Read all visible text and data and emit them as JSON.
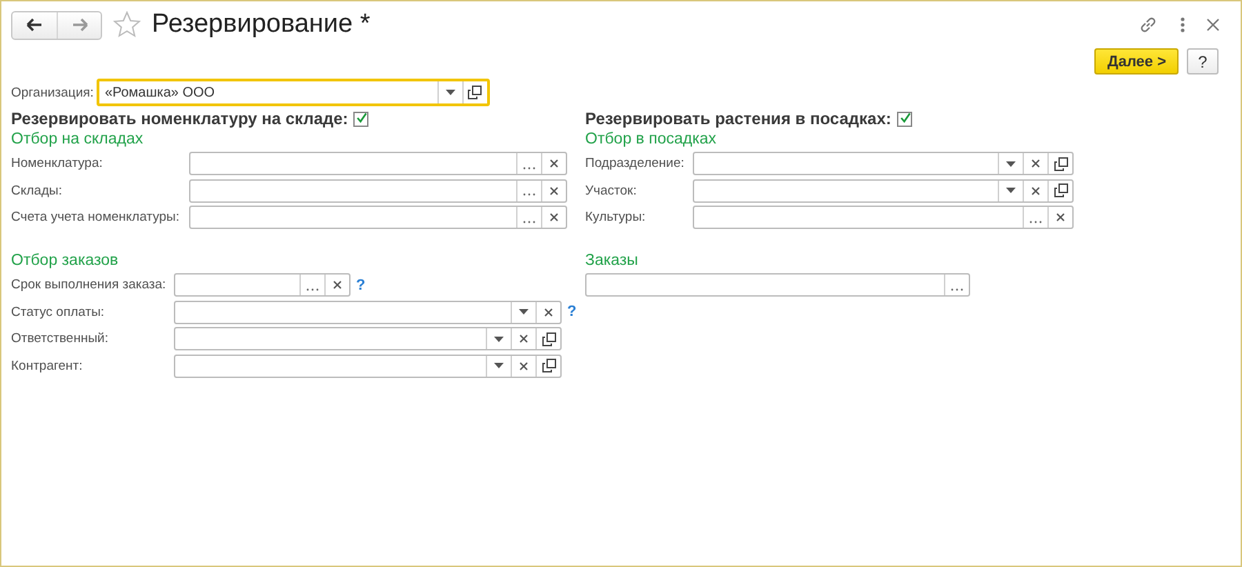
{
  "window": {
    "title": "Резервирование *"
  },
  "toolbar": {
    "next_button": "Далее >",
    "help_button": "?"
  },
  "organization": {
    "label": "Организация:",
    "value": "«Ромашка» ООО",
    "focused": true,
    "buttons": [
      {
        "kind": "dropdown"
      },
      {
        "kind": "open"
      }
    ]
  },
  "warehouse": {
    "title": "Резервировать номенклатуру на складе:",
    "checked": true,
    "filter_title": "Отбор на складах",
    "fields": [
      {
        "label": "Номенклатура:",
        "buttons": [
          {
            "kind": "select"
          },
          {
            "kind": "clear"
          }
        ]
      },
      {
        "label": "Склады:",
        "buttons": [
          {
            "kind": "select"
          },
          {
            "kind": "clear"
          }
        ]
      },
      {
        "label": "Счета учета номенклатуры:",
        "buttons": [
          {
            "kind": "select"
          },
          {
            "kind": "clear"
          }
        ]
      }
    ]
  },
  "orders_filter": {
    "title": "Отбор заказов",
    "fields": [
      {
        "label": "Срок выполнения заказа:",
        "kind": "short",
        "buttons": [
          {
            "kind": "select"
          },
          {
            "kind": "clear"
          }
        ],
        "help": "?"
      },
      {
        "label": "Статус оплаты:",
        "kind": "wide",
        "buttons": [
          {
            "kind": "dropdown"
          },
          {
            "kind": "clear"
          }
        ],
        "help": "?"
      },
      {
        "label": "Ответственный:",
        "kind": "wide",
        "buttons": [
          {
            "kind": "dropdown"
          },
          {
            "kind": "clear"
          },
          {
            "kind": "open"
          }
        ]
      },
      {
        "label": "Контрагент:",
        "kind": "wide",
        "buttons": [
          {
            "kind": "dropdown"
          },
          {
            "kind": "clear"
          },
          {
            "kind": "open"
          }
        ]
      }
    ]
  },
  "plantings": {
    "title": "Резервировать растения в посадках:",
    "checked": true,
    "filter_title": "Отбор в посадках",
    "fields": [
      {
        "label": "Подразделение:",
        "buttons": [
          {
            "kind": "dropdown"
          },
          {
            "kind": "clear"
          },
          {
            "kind": "open"
          }
        ]
      },
      {
        "label": "Участок:",
        "buttons": [
          {
            "kind": "dropdown"
          },
          {
            "kind": "clear"
          },
          {
            "kind": "open"
          }
        ]
      },
      {
        "label": "Культуры:",
        "buttons": [
          {
            "kind": "select"
          },
          {
            "kind": "clear"
          }
        ]
      }
    ]
  },
  "orders": {
    "title": "Заказы",
    "buttons": [
      {
        "kind": "select"
      }
    ]
  }
}
